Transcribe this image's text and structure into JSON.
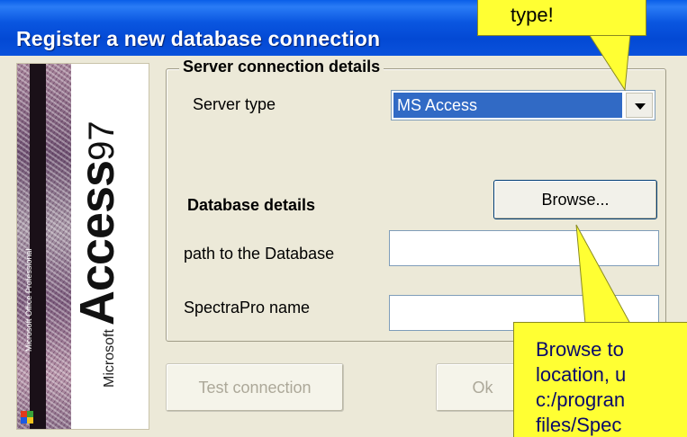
{
  "window": {
    "title": "Register a new database connection"
  },
  "banner": {
    "logo_prefix": "Microsoft",
    "logo_word": "Access",
    "logo_version": "97",
    "side_text": "Microsoft Office Professional"
  },
  "group": {
    "legend": "Server connection details",
    "server_type_label": "Server type",
    "server_type_value": "MS Access",
    "database_details_label": "Database details",
    "browse_label": "Browse...",
    "path_label": "path to the Database",
    "path_value": "",
    "name_label": "SpectraPro name",
    "name_value": ""
  },
  "buttons": {
    "test_connection": "Test connection",
    "ok": "Ok"
  },
  "callouts": {
    "top": "type!",
    "bottom_lines": [
      "Browse to",
      "location, u",
      "c:/progran",
      "files/Spec"
    ]
  },
  "colors": {
    "titlebar": "#0a5ee8",
    "callout": "#ffff33",
    "selection": "#316ac5"
  }
}
